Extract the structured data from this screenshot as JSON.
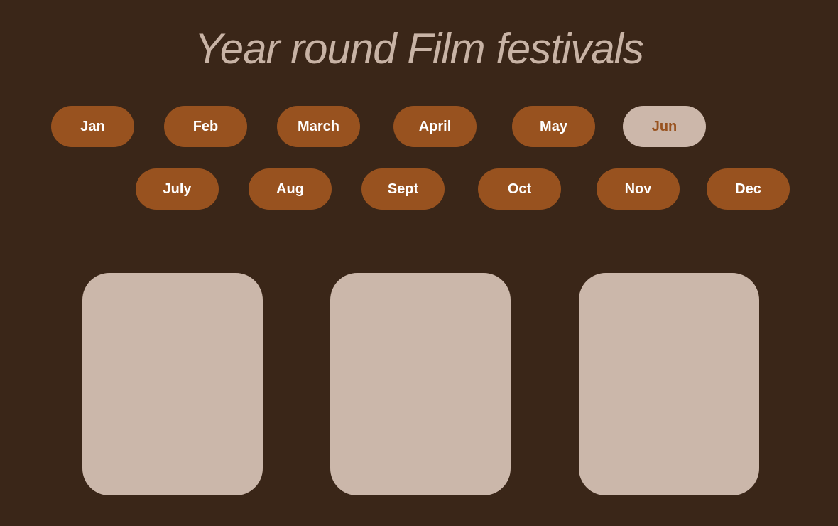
{
  "header": {
    "title": "Year round Film festivals"
  },
  "months": [
    {
      "label": "Jan",
      "active": false
    },
    {
      "label": "Feb",
      "active": false
    },
    {
      "label": "March",
      "active": false
    },
    {
      "label": "April",
      "active": false
    },
    {
      "label": "May",
      "active": false
    },
    {
      "label": "Jun",
      "active": true
    },
    {
      "label": "July",
      "active": false
    },
    {
      "label": "Aug",
      "active": false
    },
    {
      "label": "Sept",
      "active": false
    },
    {
      "label": "Oct",
      "active": false
    },
    {
      "label": "Nov",
      "active": false
    },
    {
      "label": "Dec",
      "active": false
    }
  ],
  "colors": {
    "background": "#3a2618",
    "accent": "#98521f",
    "active_pill": "#ccb7aa",
    "card": "#cbb7aa",
    "title": "#c8b3a5"
  }
}
